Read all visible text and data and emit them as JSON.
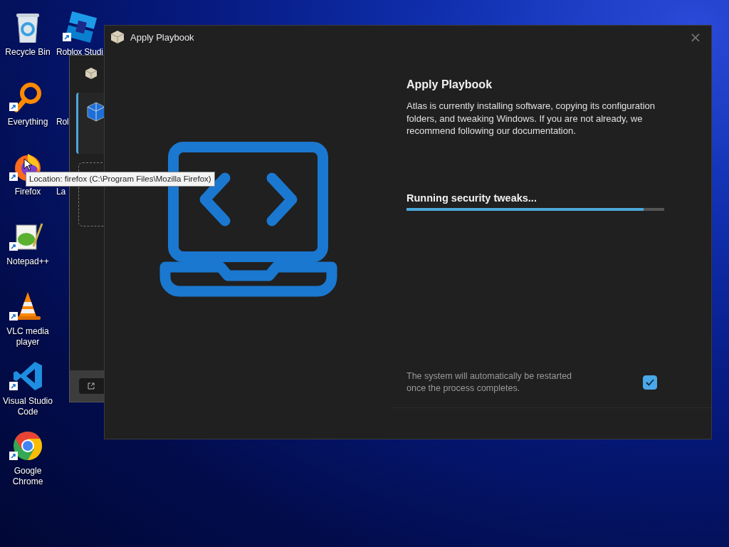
{
  "desktop_icons": [
    {
      "label": "Recycle Bin",
      "kind": "recycle",
      "shortcut": false
    },
    {
      "label": "Roblox Studi",
      "kind": "roblox",
      "shortcut": true
    },
    {
      "label": "Everything",
      "kind": "everything",
      "shortcut": true
    },
    {
      "label": "Rol",
      "kind": "hidden"
    },
    {
      "label": "Firefox",
      "kind": "firefox",
      "shortcut": true
    },
    {
      "label": "La",
      "kind": "hidden"
    },
    {
      "label": "Notepad++",
      "kind": "notepad",
      "shortcut": true
    },
    {
      "label": "VLC media player",
      "kind": "vlc",
      "shortcut": true
    },
    {
      "label": "Visual Studio Code",
      "kind": "vscode",
      "shortcut": true
    },
    {
      "label": "Google Chrome",
      "kind": "chrome",
      "shortcut": true
    }
  ],
  "background_window": {
    "sidebar_item": {
      "selected": true
    }
  },
  "window": {
    "title": "Apply Playbook",
    "close": "×",
    "heading": "Apply Playbook",
    "description": "Atlas is currently installing software, copying its configuration folders, and tweaking Windows. If you are not already, we recommend following our documentation.",
    "status": "Running security tweaks...",
    "progress": {
      "level": 0.92
    },
    "restart_note": "The system will automatically be restarted once the process completes.",
    "restart_checkbox": {
      "checked": true
    }
  },
  "tooltip": "Location: firefox (C:\\Program Files\\Mozilla Firefox)"
}
